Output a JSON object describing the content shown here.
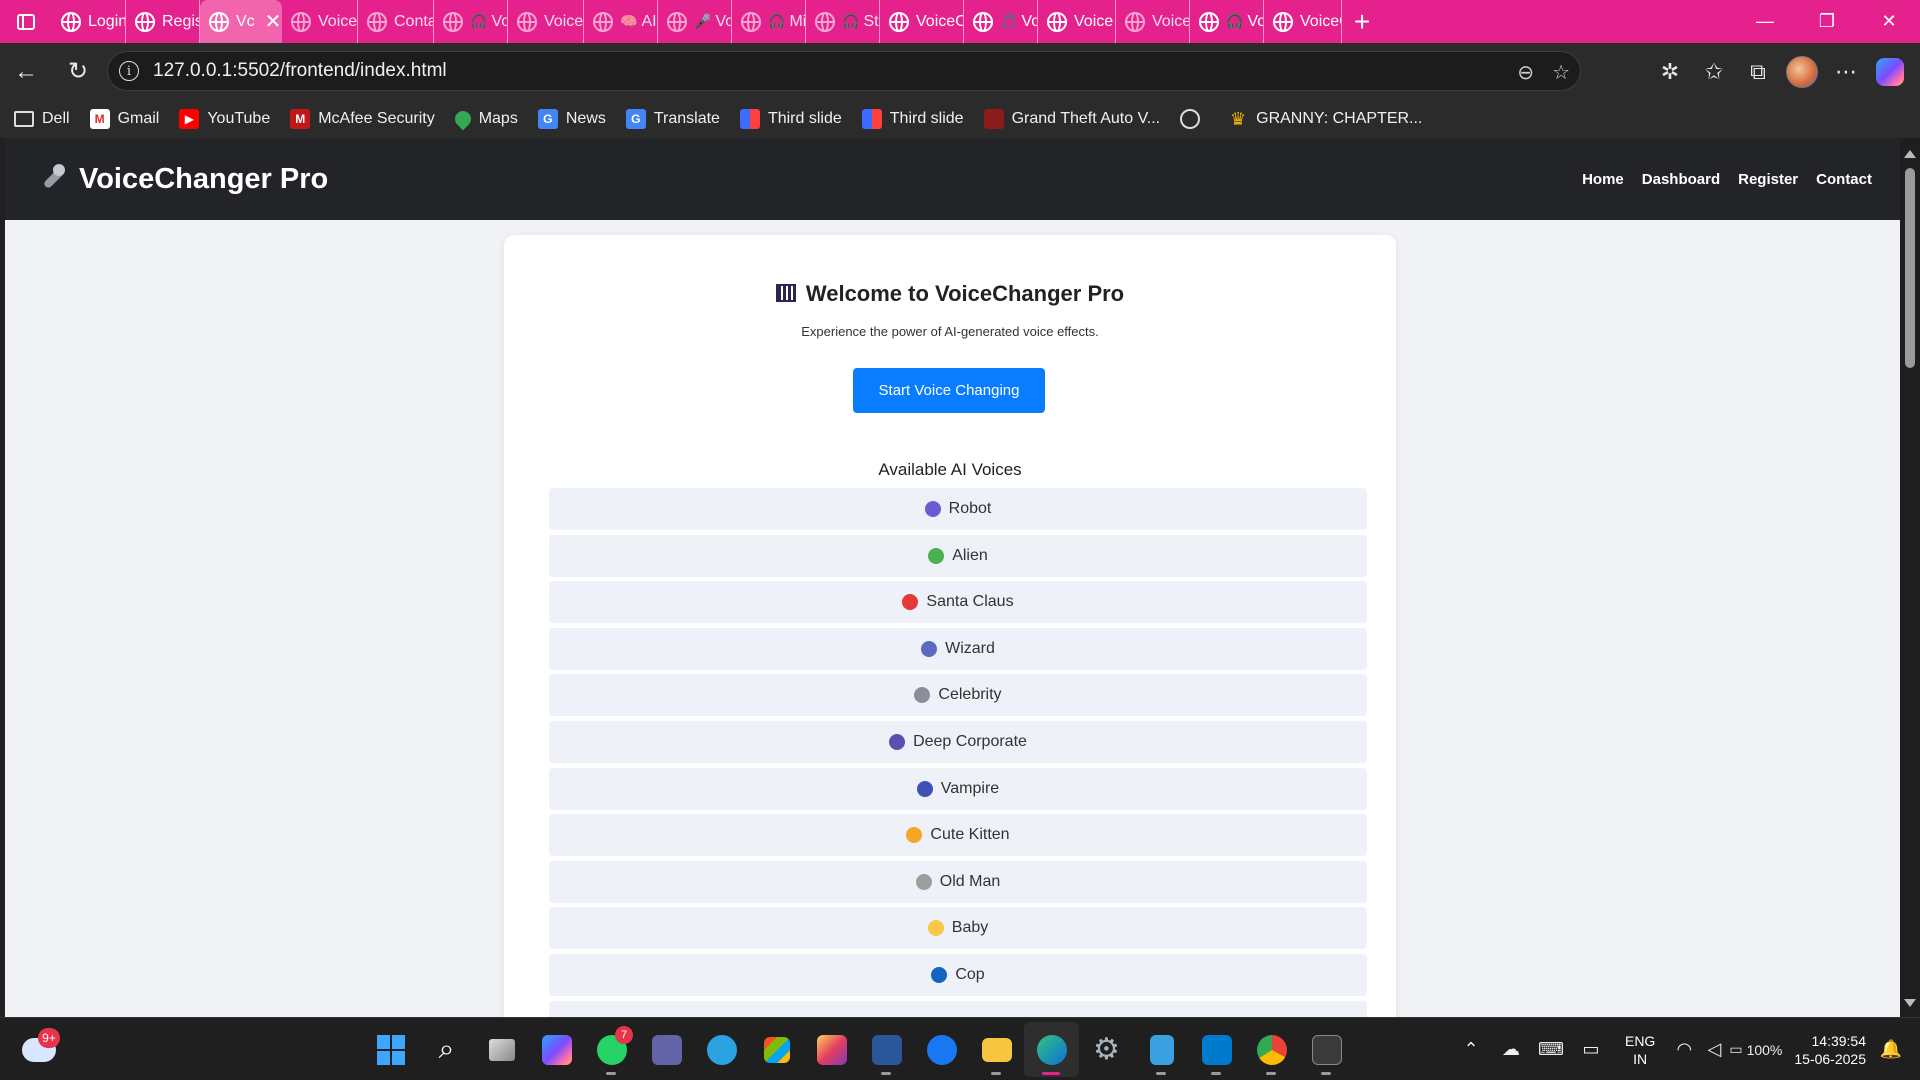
{
  "browser": {
    "tabs": [
      {
        "label": "Login",
        "sub": "",
        "dim": false
      },
      {
        "label": "Regist",
        "sub": "",
        "dim": false
      },
      {
        "label": "Vc",
        "sub": "",
        "active": true
      },
      {
        "label": "VoiceC",
        "sub": "",
        "dim": true
      },
      {
        "label": "Conta",
        "sub": "",
        "dim": true
      },
      {
        "label": "Vo",
        "sub": "🎧",
        "dim": true
      },
      {
        "label": "VoiceT",
        "sub": "",
        "dim": true
      },
      {
        "label": "AI",
        "sub": "🧠",
        "dim": true
      },
      {
        "label": "Vo",
        "sub": "🎤",
        "dim": true
      },
      {
        "label": "Mi",
        "sub": "🎧",
        "dim": true
      },
      {
        "label": "Stu",
        "sub": "🎧",
        "dim": true
      },
      {
        "label": "VoiceC",
        "sub": "",
        "dim": false
      },
      {
        "label": "Vo",
        "sub": "🎵",
        "dim": false
      },
      {
        "label": "Voice",
        "sub": "",
        "dim": false
      },
      {
        "label": "VoiceC",
        "sub": "",
        "dim": true
      },
      {
        "label": "Vo",
        "sub": "🎧",
        "dim": false
      },
      {
        "label": "VoiceC",
        "sub": "",
        "dim": false
      }
    ],
    "new_tab": "+",
    "minimize": "—",
    "restore": "❐",
    "close": "✕",
    "url": "127.0.0.1:5502/frontend/index.html",
    "bookmarks": [
      {
        "label": "Dell",
        "icon": "folder"
      },
      {
        "label": "Gmail",
        "icon": "gmail"
      },
      {
        "label": "YouTube",
        "icon": "yt"
      },
      {
        "label": "McAfee Security",
        "icon": "mcafee"
      },
      {
        "label": "Maps",
        "icon": "maps"
      },
      {
        "label": "News",
        "icon": "news"
      },
      {
        "label": "Translate",
        "icon": "translate"
      },
      {
        "label": "Third slide",
        "icon": "slide"
      },
      {
        "label": "Third slide",
        "icon": "slide"
      },
      {
        "label": "Grand Theft Auto V...",
        "icon": "gta"
      },
      {
        "label": "",
        "icon": "globe"
      },
      {
        "label": "GRANNY: CHAPTER...",
        "icon": "granny"
      }
    ]
  },
  "site": {
    "brand": "VoiceChanger Pro",
    "nav": [
      "Home",
      "Dashboard",
      "Register",
      "Contact"
    ],
    "welcome_title": "Welcome to VoiceChanger Pro",
    "subtitle": "Experience the power of AI-generated voice effects.",
    "start_button": "Start Voice Changing",
    "voices_heading": "Available AI Voices",
    "voices": [
      {
        "name": "Robot",
        "color": "#6b5cd6"
      },
      {
        "name": "Alien",
        "color": "#4caf50"
      },
      {
        "name": "Santa Claus",
        "color": "#e53935"
      },
      {
        "name": "Wizard",
        "color": "#5c6bc0"
      },
      {
        "name": "Celebrity",
        "color": "#8d8d9a"
      },
      {
        "name": "Deep Corporate",
        "color": "#5d4fb0"
      },
      {
        "name": "Vampire",
        "color": "#3f51b5"
      },
      {
        "name": "Cute Kitten",
        "color": "#f5a623"
      },
      {
        "name": "Old Man",
        "color": "#9e9e9e"
      },
      {
        "name": "Baby",
        "color": "#f7c948"
      },
      {
        "name": "Cop",
        "color": "#1565c0"
      }
    ]
  },
  "taskbar": {
    "weather_badge": "9+",
    "whatsapp_badge": "7",
    "lang_top": "ENG",
    "lang_bottom": "IN",
    "battery": "100%",
    "time": "14:39:54",
    "date": "15-06-2025"
  },
  "colors": {
    "tab_strip": "#e4218d",
    "accent_button": "#0a7cff",
    "site_nav": "#222428"
  }
}
